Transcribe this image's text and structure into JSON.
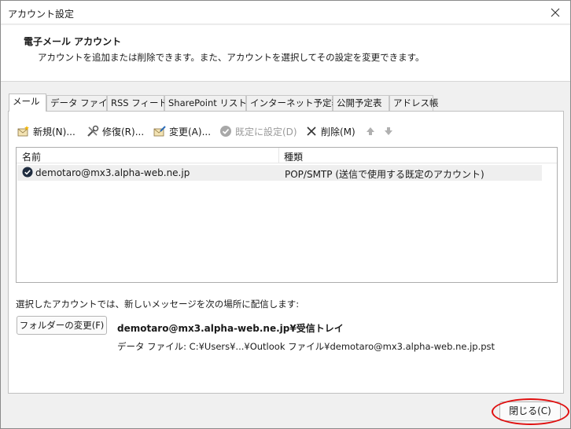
{
  "window": {
    "title": "アカウント設定"
  },
  "header": {
    "title": "電子メール アカウント",
    "description": "アカウントを追加または削除できます。また、アカウントを選択してその設定を変更できます。"
  },
  "tabs": [
    {
      "label": "メール",
      "active": true
    },
    {
      "label": "データ ファイル"
    },
    {
      "label": "RSS フィード"
    },
    {
      "label": "SharePoint リスト"
    },
    {
      "label": "インターネット予定表"
    },
    {
      "label": "公開予定表"
    },
    {
      "label": "アドレス帳"
    }
  ],
  "toolbar": {
    "new": "新規(N)...",
    "repair": "修復(R)...",
    "change": "変更(A)...",
    "set_default": "既定に設定(D)",
    "delete": "削除(M)"
  },
  "list": {
    "col_name": "名前",
    "col_type": "種類",
    "rows": [
      {
        "name": "demotaro@mx3.alpha-web.ne.jp",
        "type": "POP/SMTP (送信で使用する既定のアカウント)"
      }
    ]
  },
  "delivery": {
    "label": "選択したアカウントでは、新しいメッセージを次の場所に配信します:",
    "folder_button": "フォルダーの変更(F)",
    "target": "demotaro@mx3.alpha-web.ne.jp¥受信トレイ",
    "data_file": "データ ファイル: C:¥Users¥...¥Outlook ファイル¥demotaro@mx3.alpha-web.ne.jp.pst"
  },
  "footer": {
    "close": "閉じる(C)"
  },
  "colors": {
    "highlight": "#e01010",
    "accent": "#1e5fb0"
  }
}
